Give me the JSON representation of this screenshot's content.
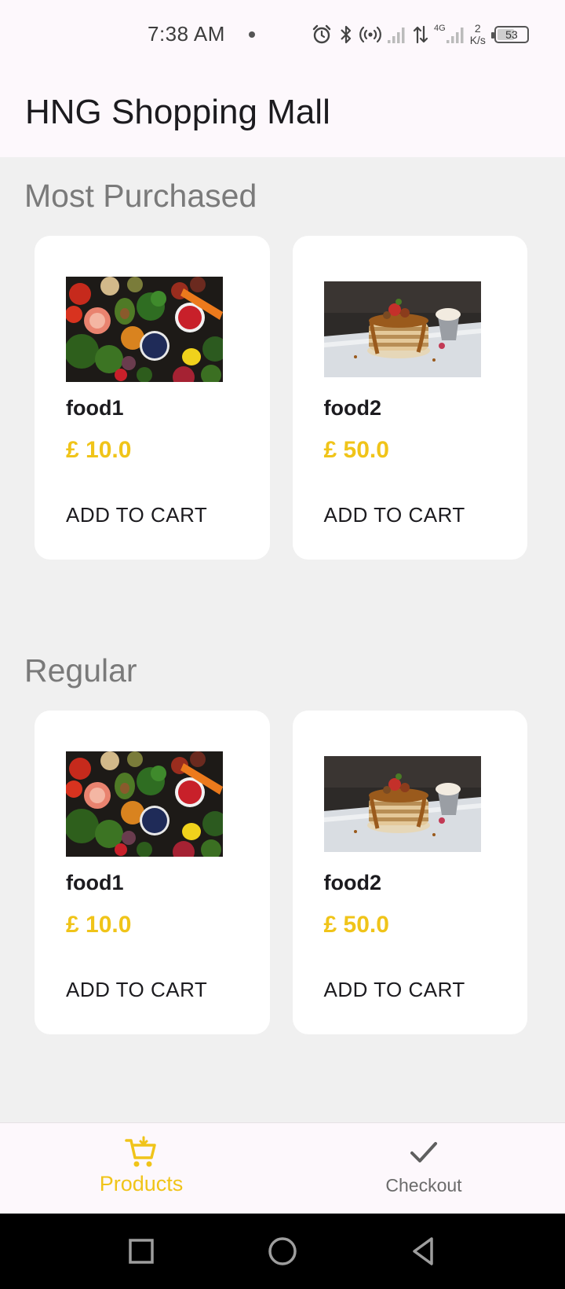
{
  "status_bar": {
    "time": "7:38 AM",
    "network_type": "4G",
    "speed_value": "2",
    "speed_unit": "K/s",
    "battery_level": "53",
    "icons": [
      "alarm-icon",
      "bluetooth-icon",
      "hotspot-icon",
      "signal-icon",
      "data-transfer-icon",
      "signal-icon",
      "battery-icon"
    ]
  },
  "app_bar": {
    "title": "HNG Shopping Mall"
  },
  "sections": [
    {
      "title": "Most Purchased",
      "products": [
        {
          "name": "food1",
          "price": "£ 10.0",
          "button": "ADD TO CART",
          "image": "vegetables-image"
        },
        {
          "name": "food2",
          "price": "£ 50.0",
          "button": "ADD TO CART",
          "image": "pancakes-image"
        }
      ]
    },
    {
      "title": "Regular",
      "products": [
        {
          "name": "food1",
          "price": "£ 10.0",
          "button": "ADD TO CART",
          "image": "vegetables-image"
        },
        {
          "name": "food2",
          "price": "£ 50.0",
          "button": "ADD TO CART",
          "image": "pancakes-image"
        }
      ]
    }
  ],
  "bottom_nav": {
    "items": [
      {
        "label": "Products",
        "icon": "cart-icon",
        "active": true
      },
      {
        "label": "Checkout",
        "icon": "check-icon",
        "active": false
      }
    ]
  },
  "colors": {
    "accent": "#f0c419",
    "surface": "#fdf8fc",
    "background": "#f0f0f0",
    "card": "#ffffff"
  }
}
